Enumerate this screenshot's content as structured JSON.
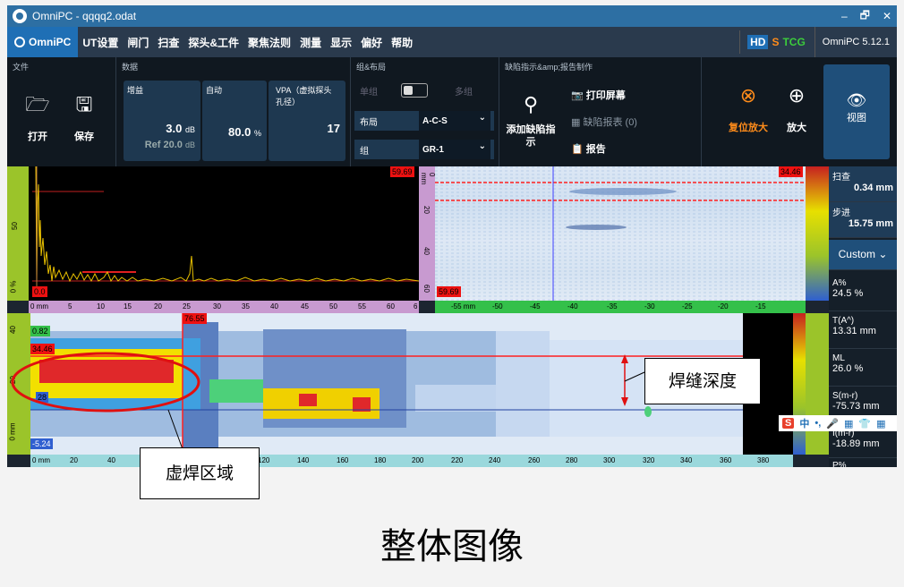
{
  "window": {
    "title": "OmniPC - qqqq2.odat",
    "minimize": "–",
    "restore": "🗗",
    "close": "✕"
  },
  "menu": {
    "brand": "OmniPC",
    "items": [
      "UT设置",
      "闸门",
      "扫查",
      "探头&工件",
      "聚焦法则",
      "测量",
      "显示",
      "偏好",
      "帮助"
    ],
    "hd": "HD",
    "s": "S",
    "tcg": "TCG",
    "version": "OmniPC 5.12.1"
  },
  "ribbon": {
    "file": {
      "label": "文件",
      "open": "打开",
      "save": "保存"
    },
    "data": {
      "label": "数据",
      "gain": {
        "label": "增益",
        "value": "3.0",
        "unit": "dB",
        "ref": "Ref 20.0",
        "ref_unit": "dB"
      },
      "auto": {
        "label": "自动",
        "value": "80.0",
        "unit": "%"
      },
      "vpa": {
        "label": "VPA（虚拟探头孔径）",
        "value": "17"
      }
    },
    "group": {
      "label": "组&布局",
      "single": "单组",
      "multi": "多组",
      "layout_label": "布局",
      "layout_value": "A-C-S",
      "group_label": "组",
      "group_value": "GR-1"
    },
    "report": {
      "label": "缺陷指示&amp;报告制作",
      "add": "添加缺陷指示",
      "print": "打印屏幕",
      "table": "缺陷报表 (0)",
      "report": "报告"
    },
    "zoom": {
      "reset": "复位放大",
      "zoom": "放大"
    },
    "view": "视图"
  },
  "ascan": {
    "gate_tag": "59.69",
    "zero_tag": "0.0",
    "y50": "50",
    "y0": "0 %",
    "ruler": [
      "0 mm",
      "5",
      "10",
      "15",
      "20",
      "25",
      "30",
      "35",
      "40",
      "45",
      "50",
      "55",
      "60",
      "6"
    ]
  },
  "sscan": {
    "tag_top": "34.46",
    "tag_bot": "59.69",
    "vruler": [
      "0 mm",
      "20",
      "40",
      "60"
    ],
    "ruler": [
      "-55 mm",
      "-50",
      "-45",
      "-40",
      "-35",
      "-30",
      "-25",
      "-20",
      "-15"
    ]
  },
  "cscan": {
    "tag_left_top": "0.82",
    "tag_left_mid": "34.46",
    "tag_left_bot": "28",
    "tag_left_low": "-5.24",
    "tag_cursor": "76.55",
    "y40": "40",
    "y20": "20",
    "y0": "0 mm",
    "ruler": [
      "0 mm",
      "20",
      "40",
      "60",
      "80",
      "100",
      "120",
      "140",
      "160",
      "180",
      "200",
      "220",
      "240",
      "260",
      "280",
      "300",
      "320",
      "340",
      "360",
      "380"
    ]
  },
  "rightpanel": {
    "scan": {
      "label": "扫查",
      "value": "0.34 mm"
    },
    "index": {
      "label": "步进",
      "value": "15.75 mm"
    },
    "custom": "Custom",
    "a": {
      "label": "A%",
      "value": "24.5 %"
    },
    "t": {
      "label": "T(A^)",
      "value": "13.31 mm"
    },
    "ml": {
      "label": "ML",
      "value": "26.0 %"
    },
    "s": {
      "label": "S(m-r)",
      "value": "-75.73 mm"
    },
    "i": {
      "label": "I(m-r)",
      "value": "-18.89 mm"
    },
    "p": {
      "label": "P%",
      "value": ""
    }
  },
  "ime": {
    "logo": "S",
    "items": [
      "中",
      "•,",
      "🎤",
      "▦",
      "👕",
      "▦"
    ]
  },
  "annotations": {
    "weld_depth": "焊缝深度",
    "false_weld": "虚焊区域"
  },
  "caption": "整体图像",
  "colors": {
    "accent": "#1f6fb5",
    "titlebar": "#2d6fa3",
    "ribbon": "#101820",
    "menubar": "#2a3a4d",
    "gate": "#ff2020"
  }
}
